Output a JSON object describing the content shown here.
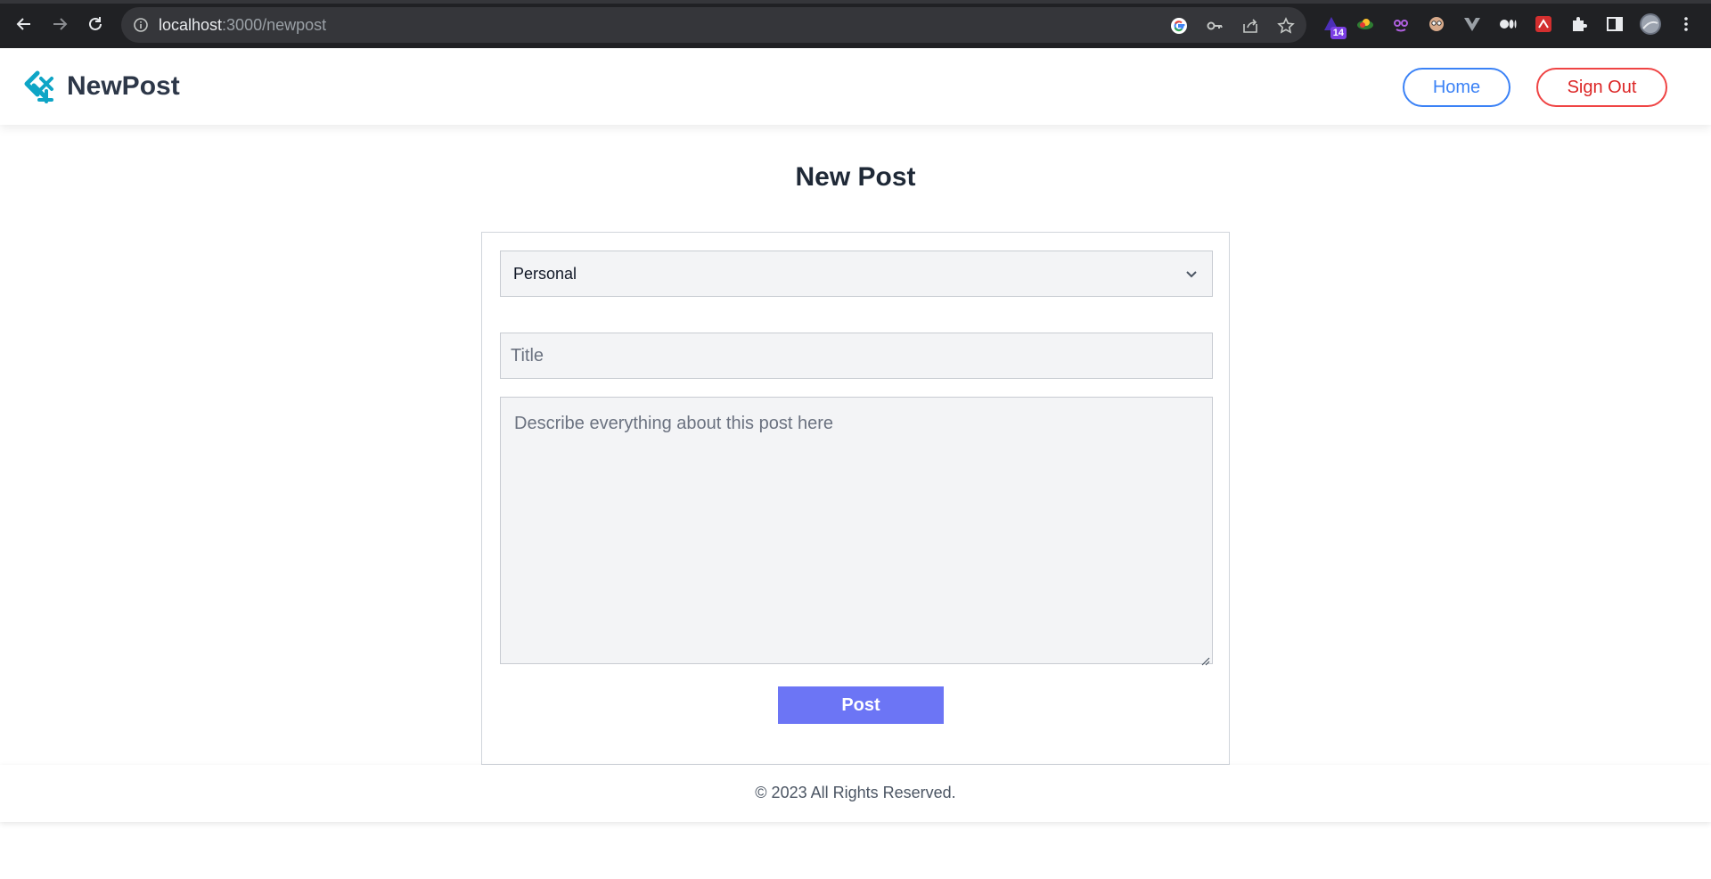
{
  "browser": {
    "url_host": "localhost",
    "url_path": ":3000/newpost",
    "extension_badge": "14",
    "icons": [
      "back-arrow-icon",
      "forward-arrow-icon",
      "reload-icon",
      "info-icon",
      "google-icon",
      "key-icon",
      "share-icon",
      "star-icon",
      "extension-icons",
      "puzzle-icon",
      "sidebar-icon",
      "profile-avatar",
      "kebab-menu-icon"
    ]
  },
  "header": {
    "brand": "NewPost",
    "home_label": "Home",
    "signout_label": "Sign Out",
    "brand_color": "#0ea5c6",
    "home_color": "#3b82f6",
    "signout_color": "#ef4444"
  },
  "main": {
    "title": "New Post",
    "form": {
      "category_selected": "Personal",
      "title_placeholder": "Title",
      "description_placeholder": "Describe everything about this post here",
      "submit_label": "Post",
      "submit_color": "#6c75f5"
    }
  },
  "footer": {
    "text": "© 2023 All Rights Reserved."
  }
}
